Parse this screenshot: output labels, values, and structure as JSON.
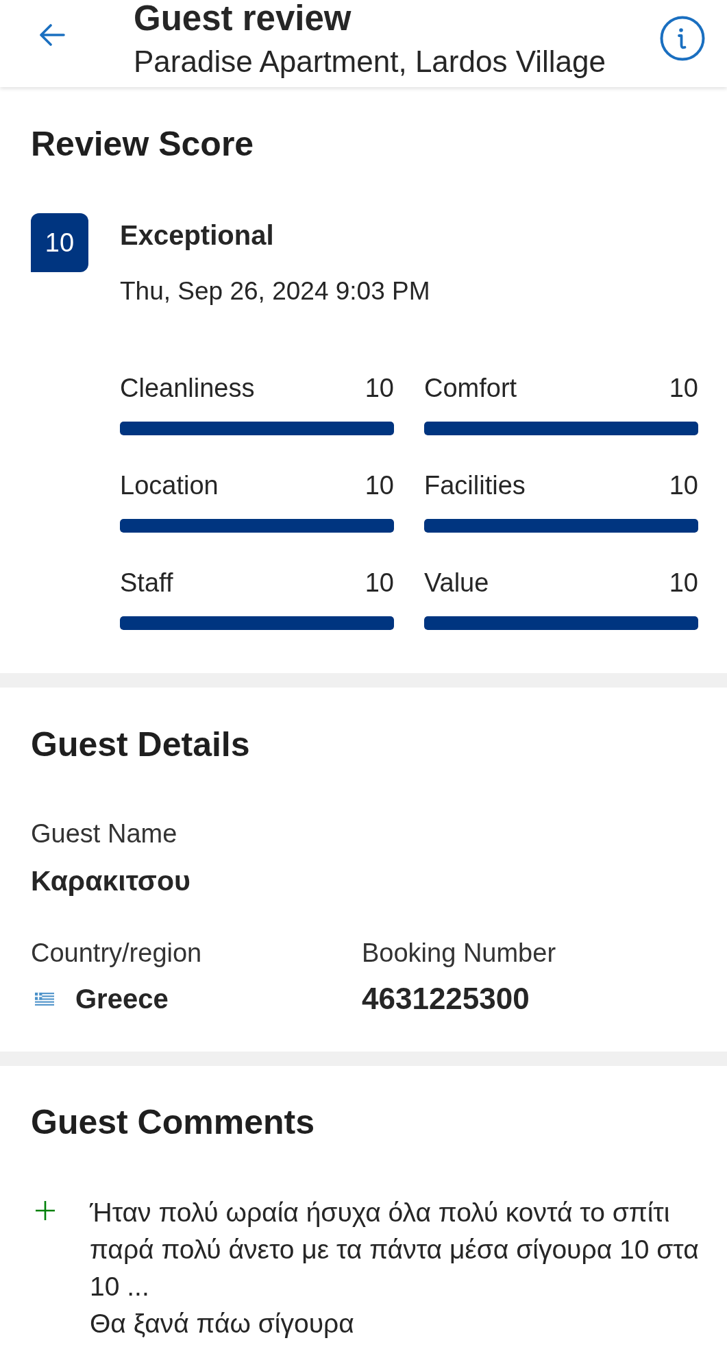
{
  "header": {
    "title": "Guest review",
    "subtitle": "Paradise Apartment, Lardos Village"
  },
  "review_score": {
    "heading": "Review Score",
    "score": "10",
    "rating": "Exceptional",
    "date": "Thu, Sep 26, 2024 9:03 PM",
    "categories": [
      {
        "name": "Cleanliness",
        "score": "10",
        "level": 1
      },
      {
        "name": "Comfort",
        "score": "10",
        "level": 1
      },
      {
        "name": "Location",
        "score": "10",
        "level": 1
      },
      {
        "name": "Facilities",
        "score": "10",
        "level": 1
      },
      {
        "name": "Staff",
        "score": "10",
        "level": 1
      },
      {
        "name": "Value",
        "score": "10",
        "level": 1
      }
    ]
  },
  "guest_details": {
    "heading": "Guest Details",
    "guest_name": {
      "label": "Guest Name",
      "value": "Καρακιτσου"
    },
    "country": {
      "label": "Country/region",
      "value": "Greece"
    },
    "booking_number": {
      "label": "Booking Number",
      "value": "4631225300"
    }
  },
  "guest_comments": {
    "heading": "Guest Comments",
    "comments": [
      {
        "kind": "positive",
        "text": "Ήταν πολύ ωραία ήσυχα όλα πολύ κοντά το σπίτι παρά πολύ άνετο με τα πάντα μέσα σίγουρα 10 στα 10 ...\nΘα ξανά πάω σίγουρα"
      }
    ]
  }
}
